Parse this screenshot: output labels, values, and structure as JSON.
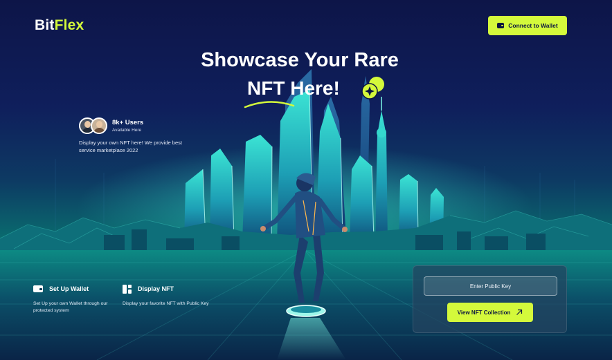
{
  "brand": {
    "name_white": "Bit",
    "name_lime": "Flex"
  },
  "header": {
    "connect_label": "Connect to Wallet"
  },
  "hero": {
    "line1": "Showcase Your Rare",
    "line2_strong": "NFT",
    "line2_rest": " Here!"
  },
  "users": {
    "count": "8k+ Users",
    "subtitle": "Available Here"
  },
  "description": "Display your own NFT here! We provide best service marketplace 2022",
  "features": [
    {
      "title": "Set Up Wallet",
      "text": "Set Up your own Wallet through our protected system",
      "icon": "wallet-icon"
    },
    {
      "title": "Display NFT",
      "text": "Display your favorite NFT with Public Key",
      "icon": "grid-icon"
    }
  ],
  "panel": {
    "input_placeholder": "Enter Public Key",
    "button_label": "View NFT Collection"
  },
  "colors": {
    "accent": "#d4f93b",
    "navy": "#0b1540",
    "teal": "#1ee0c2"
  }
}
